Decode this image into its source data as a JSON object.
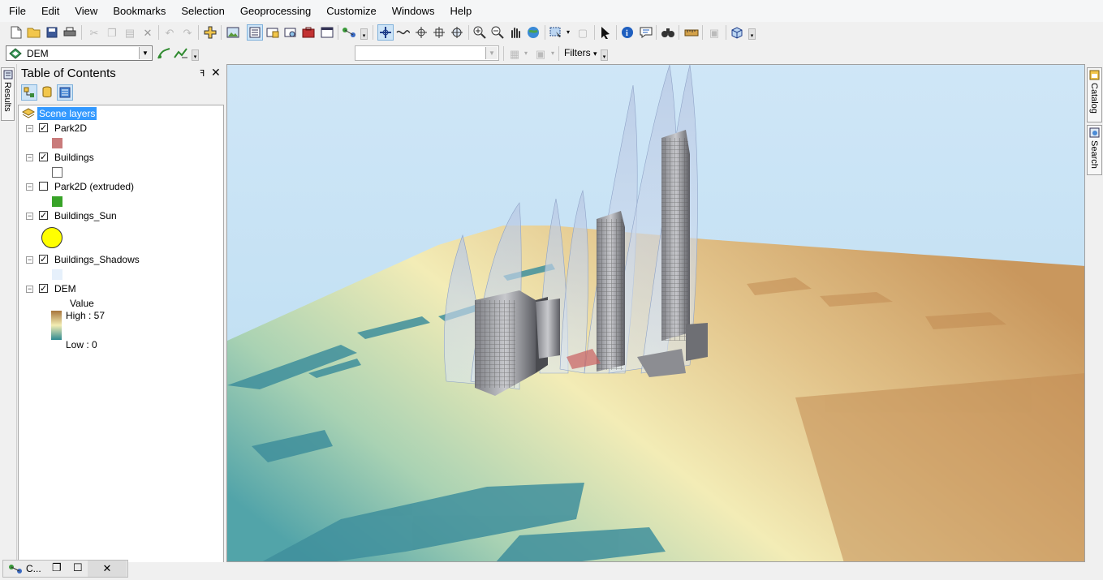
{
  "menu": [
    "File",
    "Edit",
    "View",
    "Bookmarks",
    "Selection",
    "Geoprocessing",
    "Customize",
    "Windows",
    "Help"
  ],
  "toolbar2": {
    "layer_combo_value": "DEM",
    "filters_label": "Filters",
    "dropdown_glyph": "▾"
  },
  "left_strip": {
    "results_label": "Results"
  },
  "toc": {
    "title": "Table of Contents",
    "pin_glyph": "ꟻ",
    "close_glyph": "✕",
    "group_label": "Scene layers",
    "layers": [
      {
        "name": "Park2D",
        "checked": true,
        "swatch_color": "#c97b7b"
      },
      {
        "name": "Buildings",
        "checked": true,
        "swatch_color": "#ffffff"
      },
      {
        "name": "Park2D (extruded)",
        "checked": false,
        "swatch_color": "#38a328"
      },
      {
        "name": "Buildings_Sun",
        "checked": true,
        "symbol": "circle",
        "swatch_color": "#ffff00"
      },
      {
        "name": "Buildings_Shadows",
        "checked": true,
        "swatch_color": "#e6f0fb"
      },
      {
        "name": "DEM",
        "checked": true,
        "legend": {
          "heading": "Value",
          "high": "High : 57",
          "low": "Low : 0",
          "high_color": "#a7753c",
          "low_color": "#2e8a91"
        }
      }
    ],
    "expander_glyph": "−",
    "check_glyph": "✓"
  },
  "right_strip": {
    "tabs": [
      "Catalog",
      "Search"
    ]
  },
  "bottom_tab": {
    "label": "C...",
    "restore_glyph": "❐",
    "maximize_glyph": "☐",
    "close_glyph": "✕"
  },
  "colors": {
    "sky": "#d2e8f6",
    "terrain_high": "#c9975d",
    "terrain_mid": "#f0e6b4",
    "terrain_low": "#4a9ea6",
    "selection": "#3399ff"
  }
}
